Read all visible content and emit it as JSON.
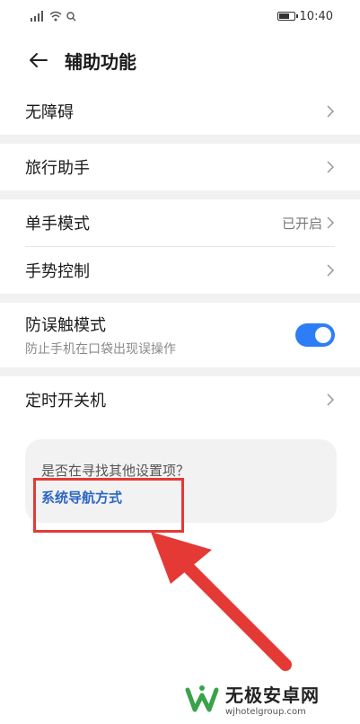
{
  "status_bar": {
    "time": "10:40",
    "battery_level": 0.75
  },
  "header": {
    "title": "辅助功能"
  },
  "settings": {
    "accessibility": {
      "label": "无障碍"
    },
    "travel": {
      "label": "旅行助手"
    },
    "one_hand": {
      "label": "单手模式",
      "value": "已开启"
    },
    "gesture": {
      "label": "手势控制"
    },
    "mistouch": {
      "label": "防误触模式",
      "sub": "防止手机在口袋出现误操作",
      "enabled": true
    },
    "timer": {
      "label": "定时开关机"
    }
  },
  "card": {
    "question": "是否在寻找其他设置项？",
    "link": "系统导航方式"
  },
  "watermark": {
    "name": "无极安卓网",
    "url": "wjhotelgroup.com"
  },
  "colors": {
    "accent": "#2d7df6",
    "link": "#2d66c4",
    "annotation_red": "#e53935"
  }
}
